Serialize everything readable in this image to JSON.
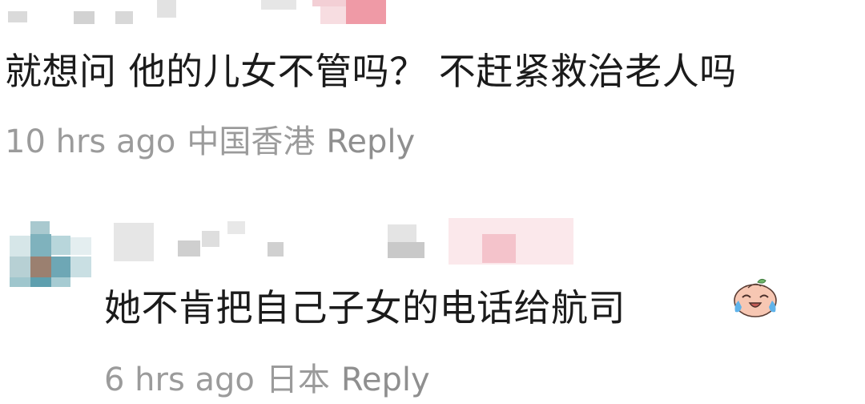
{
  "comments": [
    {
      "text": "就想问 他的儿女不管吗？ 不赶紧救治老人吗",
      "time": "10 hrs ago",
      "location": "中国香港",
      "reply_label": "Reply"
    },
    {
      "text": "她不肯把自己子女的电话给航司",
      "time": "6 hrs ago",
      "location": "日本",
      "reply_label": "Reply",
      "emoji": "crying-laughing-emoji"
    }
  ],
  "colors": {
    "text": "#1b1b1b",
    "meta": "#9b9b9b"
  }
}
